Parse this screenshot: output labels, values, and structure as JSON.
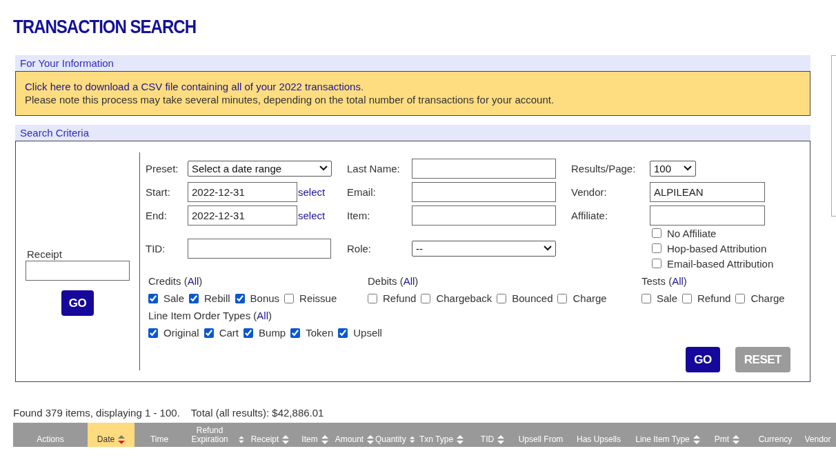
{
  "title": "TRANSACTION SEARCH",
  "info": {
    "header": "For Your Information",
    "link": "Click here to download a CSV file containing all of your 2022 transactions.",
    "note": "Please note this process may take several minutes, depending on the total number of transactions for your account."
  },
  "search": {
    "header": "Search Criteria",
    "receipt_label": "Receipt",
    "receipt_button": "GO",
    "grid": [
      [
        {
          "kind": "select",
          "label": "Preset:",
          "value": "Select a date range"
        },
        {
          "kind": "input",
          "label": "Last Name:"
        },
        {
          "kind": "select",
          "label": "Results/Page:",
          "value": "100"
        }
      ],
      [
        {
          "kind": "input",
          "label": "Start:",
          "value": "2022-12-31",
          "link": "select"
        },
        {
          "kind": "input",
          "label": "Email:"
        },
        {
          "kind": "input",
          "label": "Vendor:",
          "value": "ALPILEAN"
        }
      ],
      [
        {
          "kind": "input",
          "label": "End:",
          "value": "2022-12-31",
          "link": "select"
        },
        {
          "kind": "input",
          "label": "Item:"
        },
        {
          "kind": "input",
          "label": "Affiliate:"
        }
      ],
      [
        {
          "kind": "input",
          "label": "TID:"
        },
        {
          "kind": "select",
          "label": "Role:",
          "value": "--"
        },
        {
          "kind": "checks",
          "options": [
            {
              "label": "No Affiliate",
              "checked": false
            },
            {
              "label": "Hop-based Attribution",
              "checked": false
            },
            {
              "label": "Email-based Attribution",
              "checked": false
            }
          ]
        }
      ]
    ],
    "groups": [
      {
        "title": "Credits (",
        "all": "All",
        "close": ")",
        "items": [
          {
            "label": "Sale",
            "checked": true
          },
          {
            "label": "Rebill",
            "checked": true
          },
          {
            "label": "Bonus",
            "checked": true
          },
          {
            "label": "Reissue",
            "checked": false
          }
        ]
      },
      {
        "title": "Debits (",
        "all": "All",
        "close": ")",
        "items": [
          {
            "label": "Refund",
            "checked": false
          },
          {
            "label": "Chargeback",
            "checked": false
          },
          {
            "label": "Bounced",
            "checked": false
          },
          {
            "label": "Charge",
            "checked": false
          }
        ]
      },
      {
        "title": "Tests (",
        "all": "All",
        "close": ")",
        "items": [
          {
            "label": "Sale",
            "checked": false
          },
          {
            "label": "Refund",
            "checked": false
          },
          {
            "label": "Charge",
            "checked": false
          }
        ]
      },
      {
        "title": "Line Item Order Types (",
        "all": "All",
        "close": ")",
        "items": [
          {
            "label": "Original",
            "checked": true
          },
          {
            "label": "Cart",
            "checked": true
          },
          {
            "label": "Bump",
            "checked": true
          },
          {
            "label": "Token",
            "checked": true
          },
          {
            "label": "Upsell",
            "checked": true
          }
        ]
      }
    ],
    "buttons": [
      {
        "label": "GO",
        "disabled": false
      },
      {
        "label": "RESET",
        "disabled": true
      }
    ]
  },
  "summary": {
    "found": "Found 379 items, displaying 1 - 100.",
    "total": "Total (all results): $42,886.01"
  },
  "table": {
    "columns": [
      {
        "label": "Actions",
        "sortable": false,
        "selected": false
      },
      {
        "label": "Date",
        "sortable": true,
        "selected": true
      },
      {
        "label": "Time",
        "sortable": false,
        "selected": false
      },
      {
        "label": "Refund Expiration",
        "sortable": true,
        "selected": false
      },
      {
        "label": "Receipt",
        "sortable": true,
        "selected": false
      },
      {
        "label": "Item",
        "sortable": true,
        "selected": false
      },
      {
        "label": "Amount",
        "sortable": true,
        "selected": false
      },
      {
        "label": "Quantity",
        "sortable": true,
        "selected": false
      },
      {
        "label": "Txn Type",
        "sortable": true,
        "selected": false
      },
      {
        "label": "TID",
        "sortable": true,
        "selected": false
      },
      {
        "label": "Upsell From",
        "sortable": false,
        "selected": false
      },
      {
        "label": "Has Upsells",
        "sortable": false,
        "selected": false
      },
      {
        "label": "Line Item Type",
        "sortable": true,
        "selected": false
      },
      {
        "label": "Pmt",
        "sortable": true,
        "selected": false
      },
      {
        "label": "Currency",
        "sortable": false,
        "selected": false
      },
      {
        "label": "Vendor",
        "sortable": false,
        "selected": false
      }
    ]
  }
}
